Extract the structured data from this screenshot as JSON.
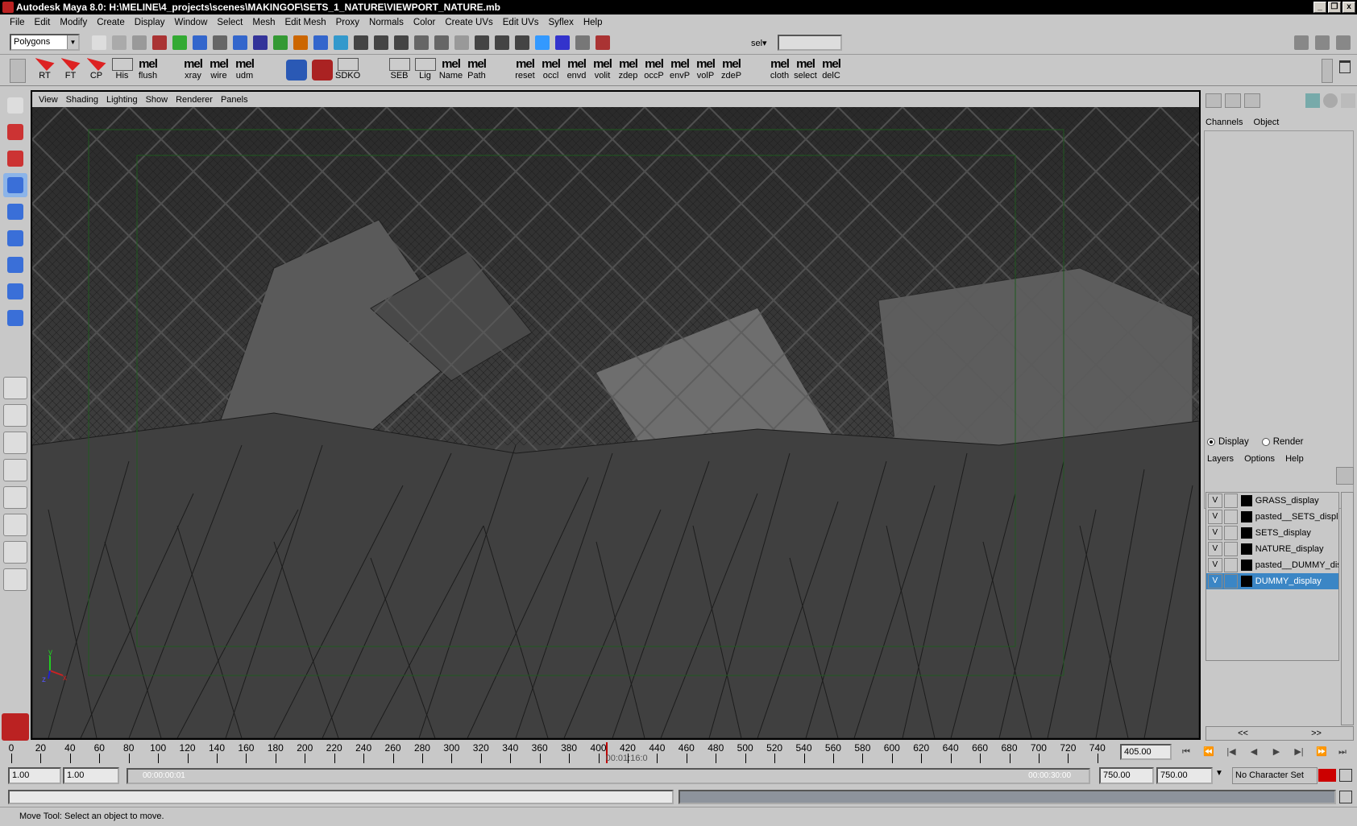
{
  "window": {
    "title": "Autodesk Maya 8.0: H:\\MELINE\\4_projects\\scenes\\MAKINGOF\\SETS_1_NATURE\\VIEWPORT_NATURE.mb",
    "buttons": [
      "_",
      "❐",
      "x"
    ]
  },
  "menubar": [
    "File",
    "Edit",
    "Modify",
    "Create",
    "Display",
    "Window",
    "Select",
    "Mesh",
    "Edit Mesh",
    "Proxy",
    "Normals",
    "Color",
    "Create UVs",
    "Edit UVs",
    "Syflex",
    "Help"
  ],
  "statusline": {
    "menu_set": "Polygons",
    "sel_label": "sel▾",
    "sel_value": ""
  },
  "shelf": [
    {
      "label": "RT",
      "kind": "arrow"
    },
    {
      "label": "FT",
      "kind": "arrow"
    },
    {
      "label": "CP",
      "kind": "arrow"
    },
    {
      "label": "His",
      "kind": "plain"
    },
    {
      "label": "flush",
      "kind": "mel"
    },
    {
      "label": "xray",
      "kind": "mel"
    },
    {
      "label": "wire",
      "kind": "mel"
    },
    {
      "label": "udm",
      "kind": "mel"
    },
    {
      "label": "",
      "kind": "icon"
    },
    {
      "label": "",
      "kind": "icon"
    },
    {
      "label": "SDKO",
      "kind": "plain"
    },
    {
      "label": "SEB",
      "kind": "plain"
    },
    {
      "label": "Lig",
      "kind": "plain"
    },
    {
      "label": "Name",
      "kind": "mel"
    },
    {
      "label": "Path",
      "kind": "mel"
    },
    {
      "label": "reset",
      "kind": "mel"
    },
    {
      "label": "occl",
      "kind": "mel"
    },
    {
      "label": "envd",
      "kind": "mel"
    },
    {
      "label": "volit",
      "kind": "mel"
    },
    {
      "label": "zdep",
      "kind": "mel"
    },
    {
      "label": "occP",
      "kind": "mel"
    },
    {
      "label": "envP",
      "kind": "mel"
    },
    {
      "label": "volP",
      "kind": "mel"
    },
    {
      "label": "zdeP",
      "kind": "mel"
    },
    {
      "label": "cloth",
      "kind": "mel"
    },
    {
      "label": "select",
      "kind": "mel"
    },
    {
      "label": "delC",
      "kind": "mel"
    }
  ],
  "mel_text": "mel",
  "viewport": {
    "menu": [
      "View",
      "Shading",
      "Lighting",
      "Show",
      "Renderer",
      "Panels"
    ],
    "axis": {
      "y": "y",
      "x": "x",
      "z": "z"
    }
  },
  "channelbox": {
    "tabs": [
      "Channels",
      "Object"
    ]
  },
  "layers": {
    "mode_display": "Display",
    "mode_render": "Render",
    "menu": [
      "Layers",
      "Options",
      "Help"
    ],
    "items": [
      {
        "vis": "V",
        "name": "GRASS_display",
        "selected": false
      },
      {
        "vis": "V",
        "name": "pasted__SETS_display",
        "selected": false
      },
      {
        "vis": "V",
        "name": "SETS_display",
        "selected": false
      },
      {
        "vis": "V",
        "name": "NATURE_display",
        "selected": false
      },
      {
        "vis": "V",
        "name": "pasted__DUMMY_display",
        "selected": false
      },
      {
        "vis": "V",
        "name": "DUMMY_display",
        "selected": true
      }
    ],
    "scroll_left": "<<",
    "scroll_right": ">>"
  },
  "timeline": {
    "ticks": [
      0,
      20,
      40,
      60,
      80,
      100,
      120,
      140,
      160,
      180,
      200,
      220,
      240,
      260,
      280,
      300,
      320,
      340,
      360,
      380,
      400,
      420,
      440,
      460,
      480,
      500,
      520,
      540,
      560,
      580,
      600,
      620,
      640,
      660,
      680,
      700,
      720,
      740
    ],
    "max": 750,
    "current_frame": "405.00",
    "timecode": "00:01:16:0",
    "current_value": 405
  },
  "range": {
    "start_a": "1.00",
    "start_b": "1.00",
    "time_start": "00:00:00:01",
    "time_end": "00:00:30:00",
    "end_a": "750.00",
    "end_b": "750.00",
    "character_set": "No Character Set"
  },
  "help": "Move Tool: Select an object to move.",
  "colors": {
    "selection": "#3b86c5",
    "timeline_marker": "#c00000"
  }
}
